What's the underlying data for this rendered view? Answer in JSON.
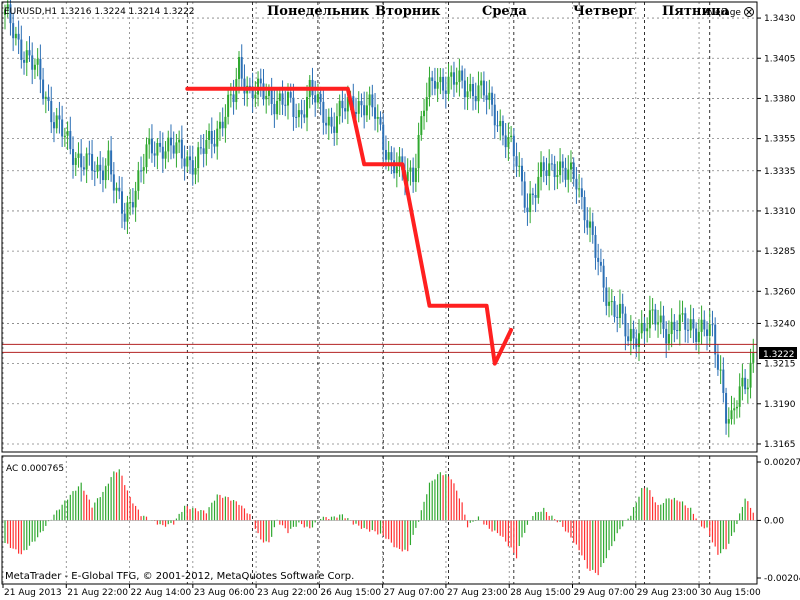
{
  "header": {
    "symbol_info": "EURUSD,H1  1.3216 1.3224 1.3214 1.3222",
    "indicator_name": "Average"
  },
  "subwindow": {
    "label": "AC 0.000765"
  },
  "footer": {
    "copyright": "MetaTrader - E-Global TFG, © 2001-2012, MetaQuotes Software Corp."
  },
  "day_labels": [
    "Понедельник",
    "Вторник",
    "Среда",
    "Четверг",
    "Пятница"
  ],
  "current_price": "1.3222",
  "colors": {
    "bull": "#2fa82f",
    "bear": "#2b6fb5",
    "trend": "#ff2020",
    "hline": "#b22222",
    "grid": "#808080",
    "ac_up": "#2fa82f",
    "ac_down": "#ff3030"
  },
  "chart_data": [
    {
      "type": "candlestick",
      "title": "EURUSD,H1",
      "y_ticks": [
        "1.3430",
        "1.3405",
        "1.3380",
        "1.3355",
        "1.3335",
        "1.3310",
        "1.3285",
        "1.3260",
        "1.3240",
        "1.3215",
        "1.3190",
        "1.3165"
      ],
      "ylim": [
        1.316,
        1.344
      ],
      "x_ticks": [
        "21 Aug 2013",
        "21 Aug 22:00",
        "22 Aug 14:00",
        "23 Aug 06:00",
        "23 Aug 22:00",
        "26 Aug 15:00",
        "27 Aug 07:00",
        "27 Aug 23:00",
        "28 Aug 15:00",
        "29 Aug 07:00",
        "29 Aug 23:00",
        "30 Aug 15:00"
      ],
      "close_profile": [
        [
          0,
          1.3432
        ],
        [
          5,
          1.3415
        ],
        [
          12,
          1.3395
        ],
        [
          18,
          1.3368
        ],
        [
          24,
          1.3348
        ],
        [
          30,
          1.334
        ],
        [
          34,
          1.3332
        ],
        [
          38,
          1.3345
        ],
        [
          41,
          1.3318
        ],
        [
          44,
          1.3305
        ],
        [
          47,
          1.3322
        ],
        [
          52,
          1.3345
        ],
        [
          58,
          1.3352
        ],
        [
          64,
          1.3346
        ],
        [
          70,
          1.334
        ],
        [
          76,
          1.3355
        ],
        [
          80,
          1.3368
        ],
        [
          84,
          1.338
        ],
        [
          86,
          1.34
        ],
        [
          90,
          1.3385
        ],
        [
          96,
          1.3382
        ],
        [
          102,
          1.3378
        ],
        [
          108,
          1.337
        ],
        [
          112,
          1.3385
        ],
        [
          116,
          1.3372
        ],
        [
          120,
          1.3365
        ],
        [
          124,
          1.3372
        ],
        [
          128,
          1.3378
        ],
        [
          132,
          1.3376
        ],
        [
          136,
          1.337
        ],
        [
          142,
          1.334
        ],
        [
          146,
          1.3332
        ],
        [
          150,
          1.3335
        ],
        [
          154,
          1.3375
        ],
        [
          158,
          1.3392
        ],
        [
          164,
          1.339
        ],
        [
          170,
          1.3388
        ],
        [
          176,
          1.3382
        ],
        [
          180,
          1.3372
        ],
        [
          184,
          1.3355
        ],
        [
          188,
          1.334
        ],
        [
          192,
          1.3315
        ],
        [
          195,
          1.3322
        ],
        [
          198,
          1.3335
        ],
        [
          202,
          1.334
        ],
        [
          206,
          1.3332
        ],
        [
          210,
          1.333
        ],
        [
          213,
          1.3312
        ],
        [
          216,
          1.329
        ],
        [
          219,
          1.3268
        ],
        [
          222,
          1.3255
        ],
        [
          226,
          1.3245
        ],
        [
          229,
          1.3228
        ],
        [
          232,
          1.3235
        ],
        [
          236,
          1.324
        ],
        [
          240,
          1.3242
        ],
        [
          244,
          1.3236
        ],
        [
          248,
          1.3238
        ],
        [
          252,
          1.324
        ],
        [
          256,
          1.3236
        ],
        [
          260,
          1.3232
        ],
        [
          263,
          1.321
        ],
        [
          265,
          1.3186
        ],
        [
          267,
          1.3178
        ],
        [
          270,
          1.3196
        ],
        [
          273,
          1.3208
        ],
        [
          275,
          1.3222
        ]
      ],
      "ac_profile": [
        [
          0,
          -0.0008
        ],
        [
          6,
          -0.0012
        ],
        [
          12,
          -0.0006
        ],
        [
          18,
          0.0002
        ],
        [
          24,
          0.0009
        ],
        [
          28,
          0.0013
        ],
        [
          32,
          0.0005
        ],
        [
          36,
          0.001
        ],
        [
          40,
          0.0017
        ],
        [
          42,
          0.0018
        ],
        [
          46,
          0.0008
        ],
        [
          50,
          0.0002
        ],
        [
          54,
          0.0
        ],
        [
          58,
          -0.0002
        ],
        [
          62,
          -0.0001
        ],
        [
          66,
          0.0005
        ],
        [
          70,
          0.0004
        ],
        [
          74,
          0.0003
        ],
        [
          78,
          0.0009
        ],
        [
          82,
          0.0008
        ],
        [
          86,
          0.0006
        ],
        [
          90,
          0.0002
        ],
        [
          94,
          -0.0007
        ],
        [
          97,
          -0.0008
        ],
        [
          100,
          0.0
        ],
        [
          104,
          -0.0004
        ],
        [
          108,
          -0.0001
        ],
        [
          112,
          -0.0003
        ],
        [
          116,
          0.0001
        ],
        [
          120,
          0.0001
        ],
        [
          124,
          0.0002
        ],
        [
          128,
          -0.0001
        ],
        [
          132,
          -0.0003
        ],
        [
          136,
          -0.0004
        ],
        [
          140,
          -0.0006
        ],
        [
          144,
          -0.001
        ],
        [
          148,
          -0.0011
        ],
        [
          152,
          0.0
        ],
        [
          156,
          0.0013
        ],
        [
          160,
          0.0017
        ],
        [
          164,
          0.0015
        ],
        [
          168,
          0.0006
        ],
        [
          170,
          -0.0002
        ],
        [
          174,
          0.0001
        ],
        [
          178,
          -0.0003
        ],
        [
          182,
          -0.0005
        ],
        [
          186,
          -0.001
        ],
        [
          188,
          -0.0013
        ],
        [
          190,
          -0.0006
        ],
        [
          194,
          0.0002
        ],
        [
          198,
          0.0004
        ],
        [
          200,
          0.0002
        ],
        [
          204,
          -0.0001
        ],
        [
          208,
          -0.0006
        ],
        [
          212,
          -0.0012
        ],
        [
          214,
          -0.0017
        ],
        [
          218,
          -0.0019
        ],
        [
          222,
          -0.0011
        ],
        [
          226,
          -0.0003
        ],
        [
          230,
          0.0002
        ],
        [
          234,
          0.0011
        ],
        [
          236,
          0.0012
        ],
        [
          240,
          0.0005
        ],
        [
          244,
          0.0008
        ],
        [
          248,
          0.0007
        ],
        [
          252,
          0.0004
        ],
        [
          256,
          -0.0002
        ],
        [
          258,
          -0.0003
        ],
        [
          262,
          -0.0012
        ],
        [
          265,
          -0.001
        ],
        [
          268,
          -0.0004
        ],
        [
          272,
          0.0008
        ],
        [
          275,
          0.0003
        ]
      ],
      "bar_count": 276,
      "trend_line": [
        [
          67,
          1.3386
        ],
        [
          126,
          1.3386
        ],
        [
          132,
          1.3339
        ],
        [
          146,
          1.3339
        ],
        [
          156,
          1.3251
        ],
        [
          177,
          1.3251
        ],
        [
          180,
          1.3215
        ],
        [
          186,
          1.3236
        ]
      ],
      "horizontal_lines": [
        1.3227,
        1.3222
      ],
      "ac_ticks": [
        "0.00207",
        "0.00",
        "-0.00204"
      ],
      "ac_ylim": [
        -0.00204,
        0.00207
      ]
    }
  ]
}
